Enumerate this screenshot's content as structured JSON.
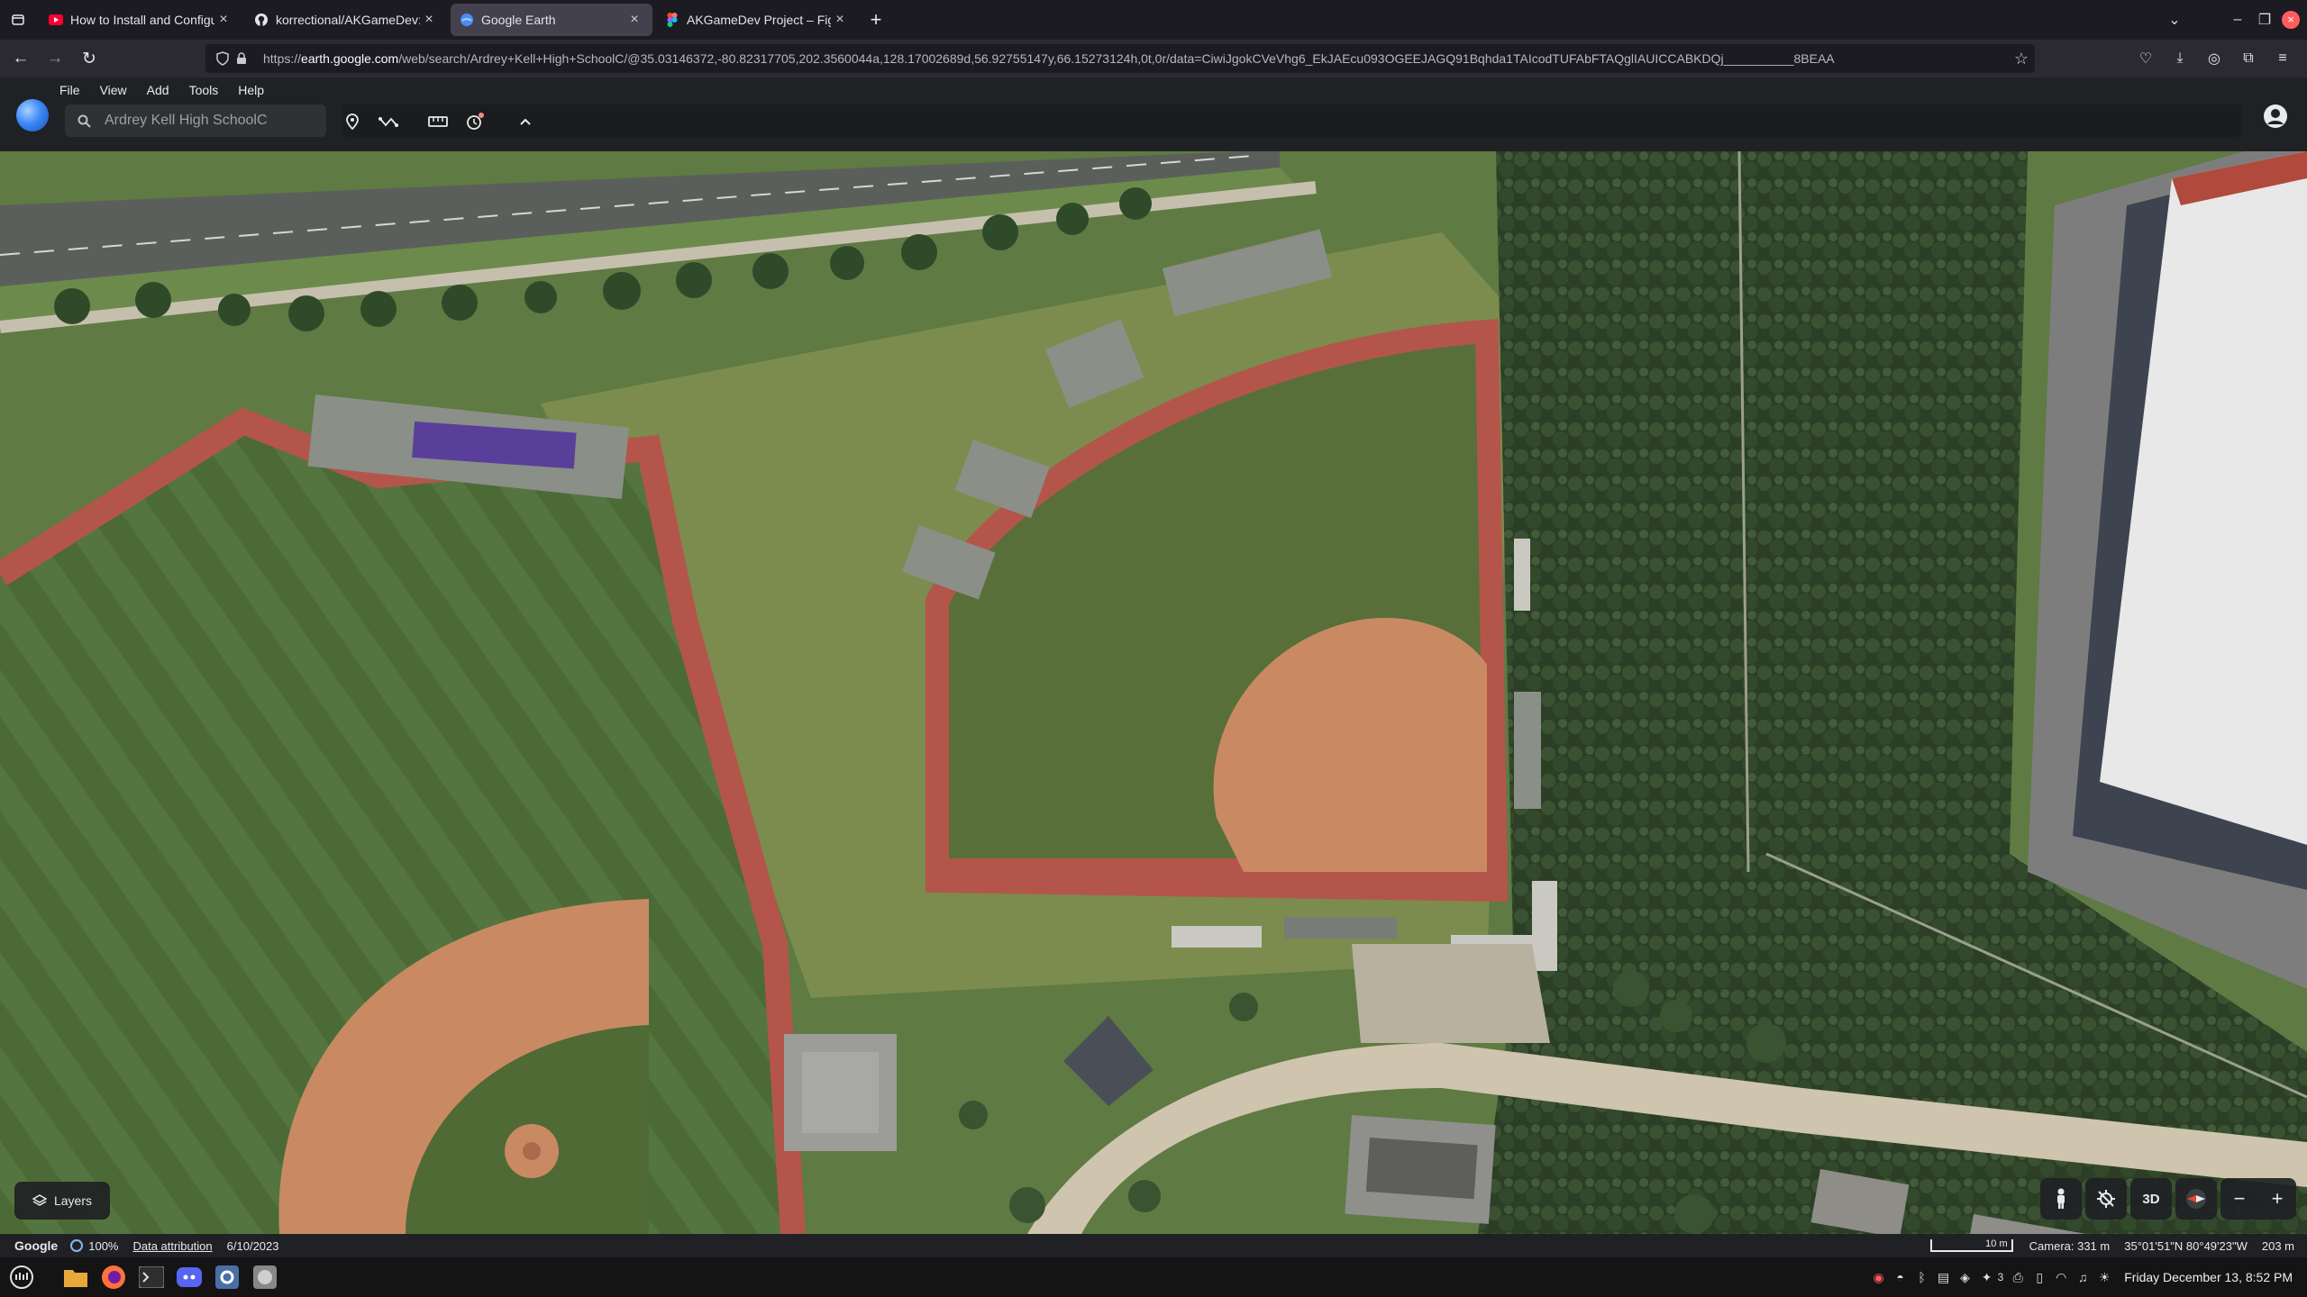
{
  "browser": {
    "tabs": [
      {
        "title": "How to Install and Configu",
        "favicon": "youtube-icon",
        "active": false
      },
      {
        "title": "korrectional/AKGameDev: ",
        "favicon": "github-icon",
        "active": false
      },
      {
        "title": "Google Earth",
        "favicon": "google-earth-icon",
        "active": true
      },
      {
        "title": "AKGameDev Project – Fig...",
        "favicon": "figma-icon",
        "active": false
      }
    ],
    "url_scheme": "https://",
    "url_domain": "earth.google.com",
    "url_rest": "/web/search/Ardrey+Kell+High+SchoolC/@35.03146372,-80.82317705,202.3560044a,128.17002689d,56.92755147y,66.15273124h,0t,0r/data=CiwiJgokCVeVhg6_EkJAEcu093OGEEJAGQ91Bqhda1TAIcodTUFAbFTAQglIAUICCABKDQj__________8BEAA"
  },
  "earth": {
    "menus": [
      "File",
      "View",
      "Add",
      "Tools",
      "Help"
    ],
    "search_value": "Ardrey Kell High SchoolC",
    "layers_label": "Layers",
    "view_3d_label": "3D",
    "zoom_out": "−",
    "zoom_in": "+"
  },
  "status": {
    "google": "Google",
    "load_percent": "100%",
    "attribution": "Data attribution",
    "imagery_date": "6/10/2023",
    "scale_label": "10 m",
    "camera": "Camera: 331 m",
    "coords": "35°01'51\"N 80°49'23\"W",
    "elevation": "203 m"
  },
  "taskbar": {
    "notification_count": "3",
    "clock": "Friday December 13, 8:52 PM"
  },
  "colors": {
    "accent": "#8ab4f8",
    "track": "#b4554b",
    "infield_dirt": "#c98a63",
    "grass": "#4f6a39"
  }
}
